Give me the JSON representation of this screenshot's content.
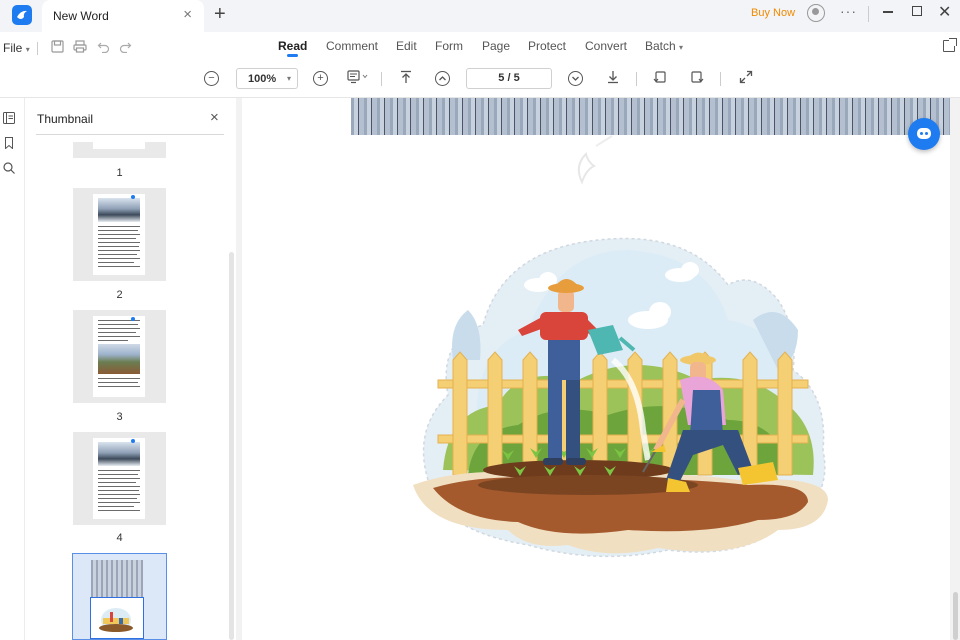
{
  "titlebar": {
    "tab_title": "New  Word",
    "close_glyph": "×",
    "new_tab_glyph": "+",
    "buy_now": "Buy Now",
    "more_glyph": "···",
    "close_window_glyph": "✕"
  },
  "menubar": {
    "file_label": "File",
    "tabs": [
      {
        "label": "Read",
        "active": true
      },
      {
        "label": "Comment",
        "active": false
      },
      {
        "label": "Edit",
        "active": false
      },
      {
        "label": "Form",
        "active": false
      },
      {
        "label": "Page",
        "active": false
      },
      {
        "label": "Protect",
        "active": false
      },
      {
        "label": "Convert",
        "active": false
      },
      {
        "label": "Batch",
        "active": false
      }
    ]
  },
  "toolbar": {
    "zoom": "100%",
    "page_indicator": "5  /  5",
    "current_page": 5,
    "total_pages": 5
  },
  "thumbnail_panel": {
    "title": "Thumbnail",
    "close_glyph": "×",
    "page_numbers": [
      "1",
      "2",
      "3",
      "4"
    ],
    "selected_page": 5
  },
  "colors": {
    "accent": "#1f7cf0",
    "buy_now": "#f08a00",
    "selection": "#5a8fe8"
  }
}
